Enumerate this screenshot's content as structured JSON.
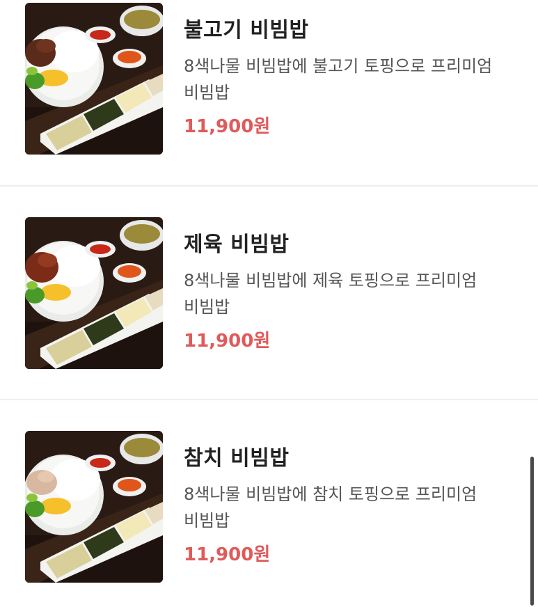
{
  "menu": {
    "items": [
      {
        "name": "불고기 비빔밥",
        "description": "8색나물 비빔밥에 불고기 토핑으로 프리미엄 비빔밥",
        "price": "11,900원",
        "image_icon": "bulgogi-bibimbap-photo"
      },
      {
        "name": "제육 비빔밥",
        "description": "8색나물 비빔밥에 제육 토핑으로 프리미엄 비빔밥",
        "price": "11,900원",
        "image_icon": "jeyuk-bibimbap-photo"
      },
      {
        "name": "참치 비빔밥",
        "description": "8색나물 비빔밥에 참치 토핑으로 프리미엄 비빔밥",
        "price": "11,900원",
        "image_icon": "tuna-bibimbap-photo"
      }
    ]
  },
  "colors": {
    "price": "#e05a5a",
    "title": "#222222",
    "description": "#555555",
    "divider": "#eeeeee"
  }
}
